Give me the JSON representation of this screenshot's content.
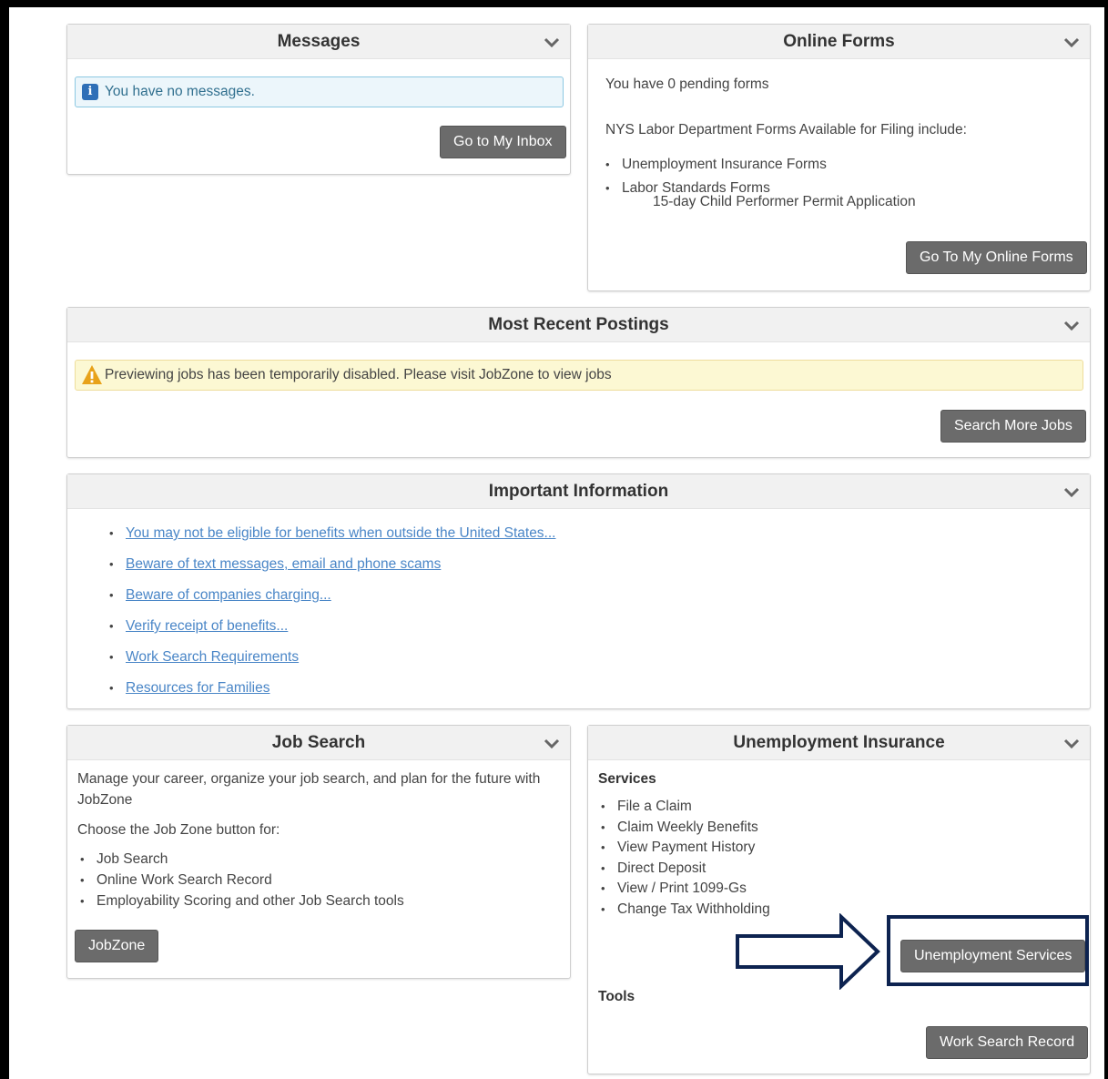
{
  "messages": {
    "title": "Messages",
    "alert": "You have no messages.",
    "button": "Go to My Inbox"
  },
  "online_forms": {
    "title": "Online Forms",
    "pending": "You have 0 pending forms",
    "intro": "NYS Labor Department Forms Available for Filing include:",
    "items": [
      "Unemployment Insurance Forms",
      "Labor Standards Forms"
    ],
    "sub_item": "15-day Child Performer Permit Application",
    "button": "Go To My Online Forms"
  },
  "postings": {
    "title": "Most Recent Postings",
    "alert": "Previewing jobs has been temporarily disabled. Please visit JobZone to view jobs",
    "button": "Search More Jobs"
  },
  "important": {
    "title": "Important Information",
    "links": [
      "You may not be eligible for benefits when outside the United States...",
      "Beware of text messages, email and phone scams",
      "Beware of companies charging...",
      "Verify receipt of benefits...",
      "Work Search Requirements",
      "Resources for Families"
    ]
  },
  "job_search": {
    "title": "Job Search",
    "desc_line1": "Manage your career, organize your job search, and plan for the future with",
    "desc_line2": "JobZone",
    "choose": "Choose the Job Zone button for:",
    "items": [
      "Job Search",
      "Online Work Search Record",
      "Employability Scoring and other Job Search tools"
    ],
    "button": "JobZone"
  },
  "ui": {
    "title": "Unemployment Insurance",
    "services_label": "Services",
    "services": [
      "File a Claim",
      "Claim Weekly Benefits",
      "View Payment History",
      "Direct Deposit",
      "View / Print 1099-Gs",
      "Change Tax Withholding"
    ],
    "services_button": "Unemployment Services",
    "tools_label": "Tools",
    "tools_button": "Work Search Record"
  },
  "colors": {
    "button_bg": "#6b6b6b",
    "highlight_border": "#0d2350",
    "link": "#4a86c7"
  }
}
